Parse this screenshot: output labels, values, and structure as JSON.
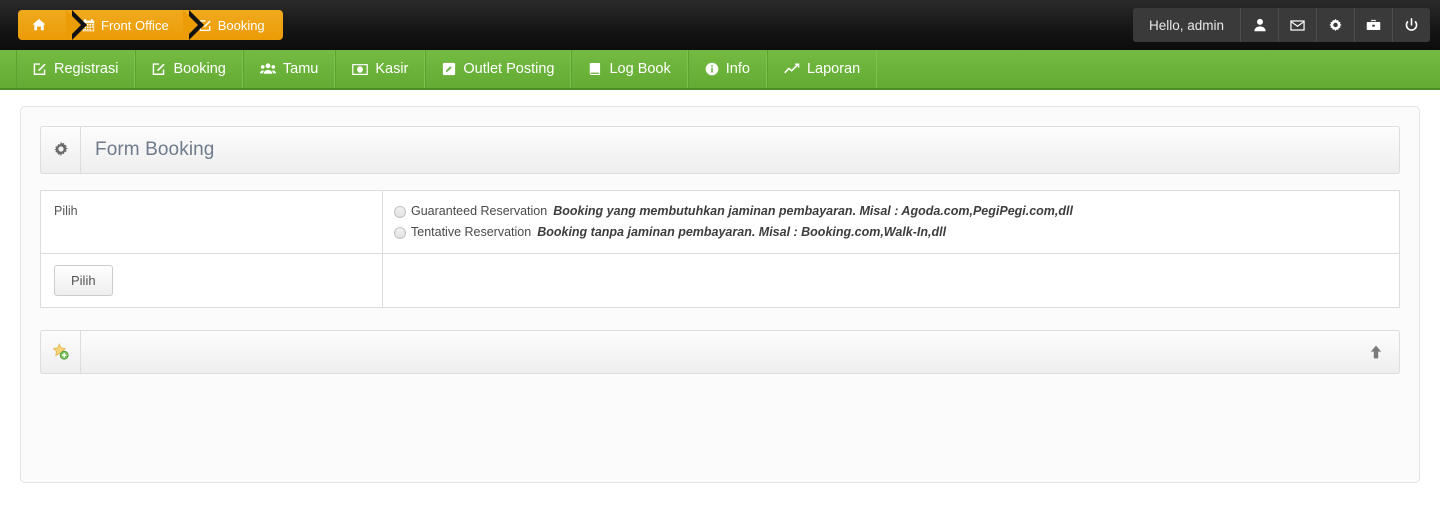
{
  "topbar": {
    "breadcrumb": [
      {
        "icon": "home-icon",
        "label": ""
      },
      {
        "icon": "calendar-icon",
        "label": "Front Office"
      },
      {
        "icon": "pencil-square-icon",
        "label": "Booking"
      }
    ],
    "user": {
      "greeting": "Hello, admin",
      "buttons": [
        {
          "icon": "user-icon"
        },
        {
          "icon": "envelope-icon"
        },
        {
          "icon": "gear-icon"
        },
        {
          "icon": "briefcase-icon"
        },
        {
          "icon": "power-icon"
        }
      ]
    }
  },
  "nav": {
    "items": [
      {
        "icon": "pencil-square-icon",
        "label": "Registrasi"
      },
      {
        "icon": "pencil-square-icon",
        "label": "Booking"
      },
      {
        "icon": "users-icon",
        "label": "Tamu"
      },
      {
        "icon": "money-icon",
        "label": "Kasir"
      },
      {
        "icon": "pencil-square-icon",
        "label": "Outlet Posting"
      },
      {
        "icon": "book-icon",
        "label": "Log Book"
      },
      {
        "icon": "info-circle-icon",
        "label": "Info"
      },
      {
        "icon": "line-chart-icon",
        "label": "Laporan"
      }
    ]
  },
  "panel": {
    "icon": "gear-icon",
    "title": "Form Booking"
  },
  "form": {
    "row_label": "Pilih",
    "options": [
      {
        "label": "Guaranteed Reservation",
        "description": "Booking yang membutuhkan jaminan pembayaran. Misal : Agoda.com,PegiPegi.com,dll",
        "selected": false
      },
      {
        "label": "Tentative Reservation",
        "description": "Booking tanpa jaminan pembayaran. Misal : Booking.com,Walk-In,dll",
        "selected": false
      }
    ],
    "submit_label": "Pilih"
  },
  "bottom_panel": {
    "icon": "star-add-icon",
    "action_icon": "arrow-up-icon"
  },
  "colors": {
    "breadcrumb_orange": "#eb9c06",
    "nav_green": "#6cb33f",
    "topbar_dark": "#161616",
    "panel_border": "#dddddd",
    "title_text": "#6f7b8a"
  }
}
